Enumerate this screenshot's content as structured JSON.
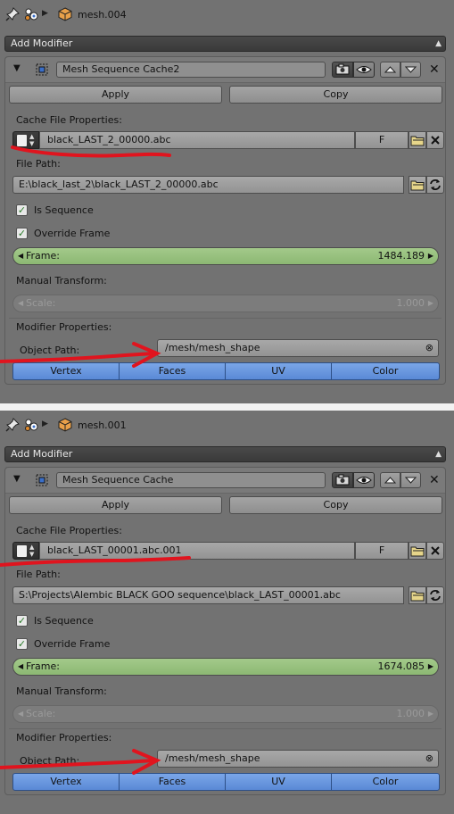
{
  "colors": {
    "panel_bg": "#727272",
    "frame_field": "#8cb873",
    "uv_buttons": "#5a89d6",
    "annotation_red": "#e0141e"
  },
  "panels": [
    {
      "object_name": "mesh.004",
      "add_modifier_label": "Add Modifier",
      "modifier_name": "Mesh Sequence Cache2",
      "apply_label": "Apply",
      "copy_label": "Copy",
      "cache_file_properties_label": "Cache File Properties:",
      "cache_file_name": "black_LAST_2_00000.abc",
      "fake_user_label": "F",
      "file_path_label": "File Path:",
      "file_path_value": "E:\\black_last_2\\black_LAST_2_00000.abc",
      "is_sequence_label": "Is Sequence",
      "override_frame_label": "Override Frame",
      "frame_label": "Frame:",
      "frame_value": "1484.189",
      "manual_transform_label": "Manual Transform:",
      "scale_label": "Scale:",
      "scale_value": "1.000",
      "modifier_properties_label": "Modifier Properties:",
      "object_path_label": "Object Path:",
      "object_path_value": "/mesh/mesh_shape",
      "read_data": [
        "Vertex",
        "Faces",
        "UV",
        "Color"
      ]
    },
    {
      "object_name": "mesh.001",
      "add_modifier_label": "Add Modifier",
      "modifier_name": "Mesh Sequence Cache",
      "apply_label": "Apply",
      "copy_label": "Copy",
      "cache_file_properties_label": "Cache File Properties:",
      "cache_file_name": "black_LAST_00001.abc.001",
      "fake_user_label": "F",
      "file_path_label": "File Path:",
      "file_path_value": "S:\\Projects\\Alembic BLACK GOO sequence\\black_LAST_00001.abc",
      "is_sequence_label": "Is Sequence",
      "override_frame_label": "Override Frame",
      "frame_label": "Frame:",
      "frame_value": "1674.085",
      "manual_transform_label": "Manual Transform:",
      "scale_label": "Scale:",
      "scale_value": "1.000",
      "modifier_properties_label": "Modifier Properties:",
      "object_path_label": "Object Path:",
      "object_path_value": "/mesh/mesh_shape",
      "read_data": [
        "Vertex",
        "Faces",
        "UV",
        "Color"
      ]
    }
  ]
}
